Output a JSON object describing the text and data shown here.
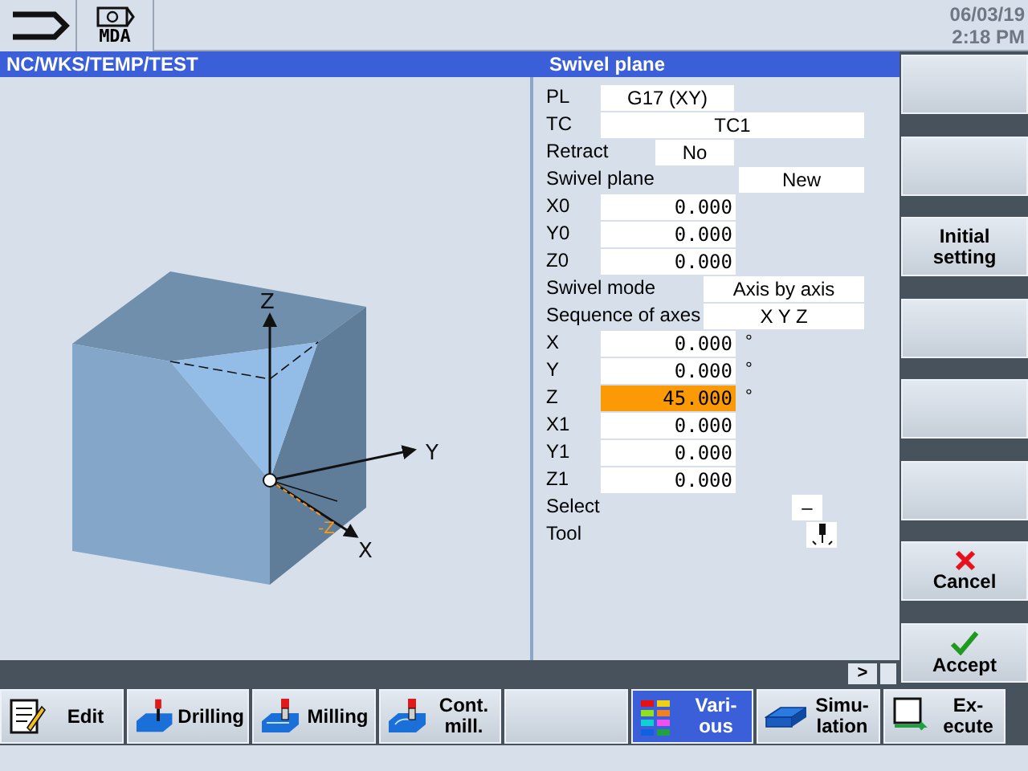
{
  "top_bar": {
    "buttons": [
      {
        "kind": "back"
      },
      {
        "kind": "mda",
        "label": "MDA"
      }
    ],
    "date": "06/03/19",
    "time": "2:18 PM"
  },
  "header": {
    "path": "NC/WKS/TEMP/TEST",
    "form_title": "Swivel plane"
  },
  "graphic": {
    "axis_labels": [
      "Z",
      "Y",
      "X",
      "-Z"
    ]
  },
  "form": [
    {
      "label": "PL",
      "value": "G17 (XY)",
      "kind": "short-center",
      "selected": false
    },
    {
      "label": "TC",
      "value": "TC1",
      "kind": "wide",
      "selected": false
    },
    {
      "label": "Retract",
      "value": "No",
      "kind": "small",
      "selected": false
    },
    {
      "label": "Swivel plane",
      "value": "New",
      "kind": "right",
      "selected": false
    },
    {
      "label": "X0",
      "value": "0.000",
      "kind": "number",
      "selected": false
    },
    {
      "label": "Y0",
      "value": "0.000",
      "kind": "number",
      "selected": false
    },
    {
      "label": "Z0",
      "value": "0.000",
      "kind": "number",
      "selected": false
    },
    {
      "label": "Swivel mode",
      "value": "Axis by axis",
      "kind": "mode",
      "selected": false
    },
    {
      "label": "Sequence of axes",
      "value": "X Y Z",
      "kind": "mode",
      "selected": false
    },
    {
      "label": "X",
      "value": "0.000",
      "unit": "°",
      "kind": "number",
      "selected": false
    },
    {
      "label": "Y",
      "value": "0.000",
      "unit": "°",
      "kind": "number",
      "selected": false
    },
    {
      "label": "Z",
      "value": "45.000",
      "unit": "°",
      "kind": "number",
      "selected": true
    },
    {
      "label": "X1",
      "value": "0.000",
      "kind": "number",
      "selected": false
    },
    {
      "label": "Y1",
      "value": "0.000",
      "kind": "number",
      "selected": false
    },
    {
      "label": "Z1",
      "value": "0.000",
      "kind": "number",
      "selected": false
    },
    {
      "label": "Select",
      "value": "–",
      "kind": "select",
      "selected": false
    },
    {
      "label": "Tool",
      "kind": "tool",
      "selected": false
    }
  ],
  "scroll_button": ">",
  "vertical_softkeys": [
    {
      "kind": "blank"
    },
    {
      "kind": "blank"
    },
    {
      "kind": "text",
      "label": "Initial setting"
    },
    {
      "kind": "blank"
    },
    {
      "kind": "blank"
    },
    {
      "kind": "blank"
    },
    {
      "kind": "cancel",
      "label": "Cancel"
    },
    {
      "kind": "accept",
      "label": "Accept"
    }
  ],
  "bottom_softkeys": [
    {
      "label": "Edit",
      "kind": "edit",
      "selected": false
    },
    {
      "label": "Drilling",
      "kind": "drill",
      "selected": false
    },
    {
      "label": "Milling",
      "kind": "mill",
      "selected": false
    },
    {
      "label": "Cont. mill.",
      "kind": "contour",
      "selected": false
    },
    {
      "kind": "blank",
      "selected": false
    },
    {
      "label": "Vari-ous",
      "kind": "various",
      "selected": true
    },
    {
      "label": "Simu-lation",
      "kind": "sim",
      "selected": false
    },
    {
      "label": "Ex-ecute",
      "kind": "execute",
      "selected": false
    }
  ]
}
